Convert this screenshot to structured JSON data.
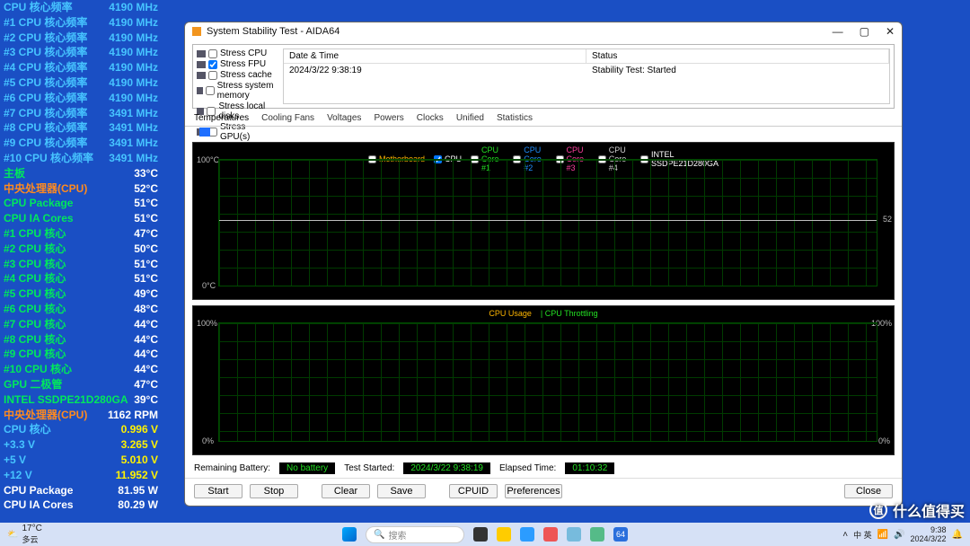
{
  "osd": {
    "freq": [
      {
        "label": "CPU 核心频率",
        "value": "4190 MHz"
      },
      {
        "label": "#1 CPU 核心频率",
        "value": "4190 MHz"
      },
      {
        "label": "#2 CPU 核心频率",
        "value": "4190 MHz"
      },
      {
        "label": "#3 CPU 核心频率",
        "value": "4190 MHz"
      },
      {
        "label": "#4 CPU 核心频率",
        "value": "4190 MHz"
      },
      {
        "label": "#5 CPU 核心频率",
        "value": "4190 MHz"
      },
      {
        "label": "#6 CPU 核心频率",
        "value": "4190 MHz"
      },
      {
        "label": "#7 CPU 核心频率",
        "value": "3491 MHz"
      },
      {
        "label": "#8 CPU 核心频率",
        "value": "3491 MHz"
      },
      {
        "label": "#9 CPU 核心频率",
        "value": "3491 MHz"
      },
      {
        "label": "#10 CPU 核心频率",
        "value": "3491 MHz"
      }
    ],
    "temps": [
      {
        "label": "主板",
        "value": "33°C"
      },
      {
        "label": "中央处理器(CPU)",
        "value": "52°C",
        "cpu": true
      },
      {
        "label": "CPU Package",
        "value": "51°C"
      },
      {
        "label": "CPU IA Cores",
        "value": "51°C"
      },
      {
        "label": "#1 CPU 核心",
        "value": "47°C"
      },
      {
        "label": "#2 CPU 核心",
        "value": "50°C"
      },
      {
        "label": "#3 CPU 核心",
        "value": "51°C"
      },
      {
        "label": "#4 CPU 核心",
        "value": "51°C"
      },
      {
        "label": "#5 CPU 核心",
        "value": "49°C"
      },
      {
        "label": "#6 CPU 核心",
        "value": "48°C"
      },
      {
        "label": "#7 CPU 核心",
        "value": "44°C"
      },
      {
        "label": "#8 CPU 核心",
        "value": "44°C"
      },
      {
        "label": "#9 CPU 核心",
        "value": "44°C"
      },
      {
        "label": "#10 CPU 核心",
        "value": "44°C"
      },
      {
        "label": "GPU 二极管",
        "value": "47°C"
      },
      {
        "label": "INTEL SSDPE21D280GA",
        "value": "39°C"
      }
    ],
    "fan": {
      "label": "中央处理器(CPU)",
      "value": "1162 RPM"
    },
    "volts": [
      {
        "label": "CPU 核心",
        "value": "0.996 V"
      },
      {
        "label": "+3.3 V",
        "value": "3.265 V"
      },
      {
        "label": "+5 V",
        "value": "5.010 V"
      },
      {
        "label": "+12 V",
        "value": "11.952 V"
      }
    ],
    "power": [
      {
        "label": "CPU Package",
        "value": "81.95 W"
      },
      {
        "label": "CPU IA Cores",
        "value": "80.29 W"
      }
    ]
  },
  "window": {
    "title": "System Stability Test - AIDA64",
    "stress": [
      {
        "label": "Stress CPU",
        "checked": false
      },
      {
        "label": "Stress FPU",
        "checked": true
      },
      {
        "label": "Stress cache",
        "checked": false
      },
      {
        "label": "Stress system memory",
        "checked": false
      },
      {
        "label": "Stress local disks",
        "checked": false
      },
      {
        "label": "Stress GPU(s)",
        "checked": false
      }
    ],
    "info": {
      "h1": "Date & Time",
      "h2": "Status",
      "c1": "2024/3/22 9:38:19",
      "c2": "Stability Test: Started"
    },
    "tabs": [
      "Temperatures",
      "Cooling Fans",
      "Voltages",
      "Powers",
      "Clocks",
      "Unified",
      "Statistics"
    ],
    "active_tab": 0,
    "graph1": {
      "ymax": "100°C",
      "ymin": "0°C",
      "readout": "52",
      "legend": [
        {
          "name": "Motherboard",
          "color": "#ffb600",
          "checked": false
        },
        {
          "name": "CPU",
          "color": "#ffffff",
          "checked": true
        },
        {
          "name": "CPU Core #1",
          "color": "#23e023",
          "checked": false
        },
        {
          "name": "CPU Core #2",
          "color": "#1f8fff",
          "checked": false
        },
        {
          "name": "CPU Core #3",
          "color": "#ff3f9f",
          "checked": false
        },
        {
          "name": "CPU Core #4",
          "color": "#d0d0d0",
          "checked": false
        },
        {
          "name": "INTEL SSDPE21D280GA",
          "color": "#ffffff",
          "checked": false
        }
      ]
    },
    "graph2": {
      "ymax": "100%",
      "ymin": "0%",
      "rmax": "100%",
      "rmin": "0%",
      "legend": [
        {
          "name": "CPU Usage",
          "color": "#ffb600"
        },
        {
          "name": "CPU Throttling",
          "color": "#23e023"
        }
      ]
    },
    "status": {
      "battery_label": "Remaining Battery:",
      "battery": "No battery",
      "started_label": "Test Started:",
      "started": "2024/3/22 9:38:19",
      "elapsed_label": "Elapsed Time:",
      "elapsed": "01:10:32"
    },
    "buttons": {
      "start": "Start",
      "stop": "Stop",
      "clear": "Clear",
      "save": "Save",
      "cpuid": "CPUID",
      "prefs": "Preferences",
      "close": "Close"
    }
  },
  "taskbar": {
    "weather_temp": "17°C",
    "weather_desc": "多云",
    "search_icon": "🔍",
    "search_placeholder": "搜索",
    "time": "9:38",
    "date": "2024/3/22"
  },
  "watermark": "值|什么值得买"
}
